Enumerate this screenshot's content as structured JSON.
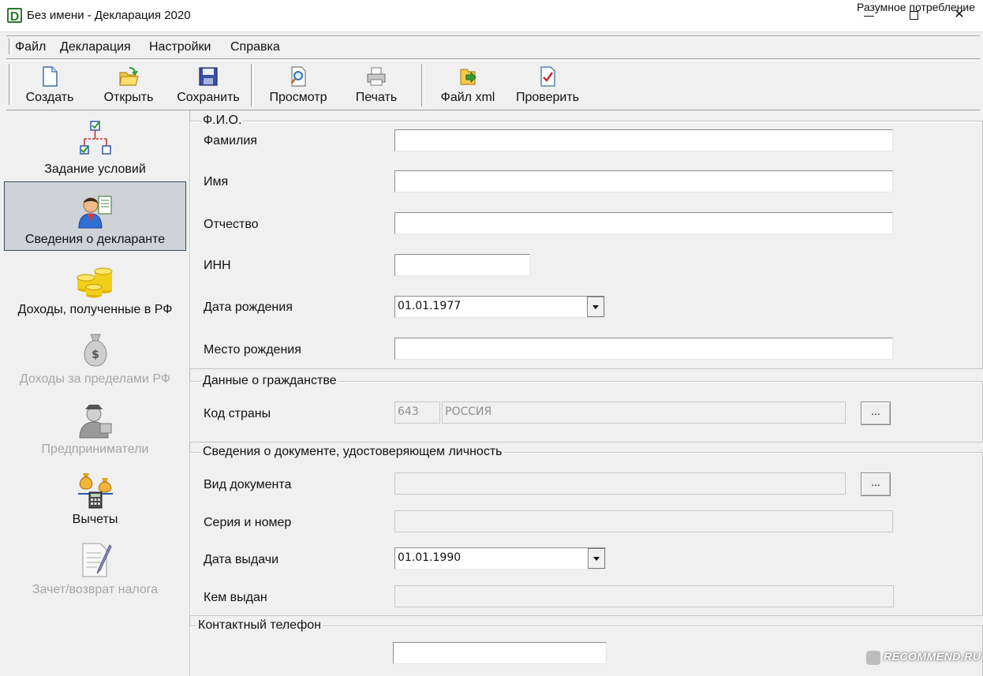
{
  "window": {
    "title": "Без имени - Декларация 2020",
    "app_icon_letter": "D",
    "watermark_top": "Разумное потребление"
  },
  "menu": [
    "Файл",
    "Декларация",
    "Настройки",
    "Справка"
  ],
  "toolbar": {
    "create": "Создать",
    "open": "Открыть",
    "save": "Сохранить",
    "preview": "Просмотр",
    "print": "Печать",
    "xml": "Файл xml",
    "check": "Проверить"
  },
  "sidebar": {
    "items": [
      {
        "label": "Задание условий",
        "state": "normal"
      },
      {
        "label": "Сведения о декларанте",
        "state": "active"
      },
      {
        "label": "Доходы, полученные в РФ",
        "state": "normal"
      },
      {
        "label": "Доходы за пределами РФ",
        "state": "disabled"
      },
      {
        "label": "Предприниматели",
        "state": "disabled"
      },
      {
        "label": "Вычеты",
        "state": "normal"
      },
      {
        "label": "Зачет/возврат налога",
        "state": "disabled"
      }
    ]
  },
  "fio": {
    "title": "Ф.И.О.",
    "surname_label": "Фамилия",
    "surname_value": "",
    "name_label": "Имя",
    "name_value": "",
    "patronymic_label": "Отчество",
    "patronymic_value": "",
    "inn_label": "ИНН",
    "inn_value": "",
    "birthdate_label": "Дата рождения",
    "birthdate_value": "01.01.1977",
    "birthplace_label": "Место рождения",
    "birthplace_value": ""
  },
  "citizenship": {
    "title": "Данные о гражданстве",
    "country_label": "Код страны",
    "country_code": "643",
    "country_name": "РОССИЯ",
    "browse": "..."
  },
  "document": {
    "title": "Сведения о документе, удостоверяющем личность",
    "type_label": "Вид документа",
    "type_value": "",
    "browse": "...",
    "series_label": "Серия и номер",
    "series_value": "",
    "issue_date_label": "Дата выдачи",
    "issue_date_value": "01.01.1990",
    "issued_by_label": "Кем выдан",
    "issued_by_value": ""
  },
  "contact": {
    "title": "Контактный телефон",
    "phone_value": ""
  },
  "watermark_bottom": "RECOMMEND.RU"
}
